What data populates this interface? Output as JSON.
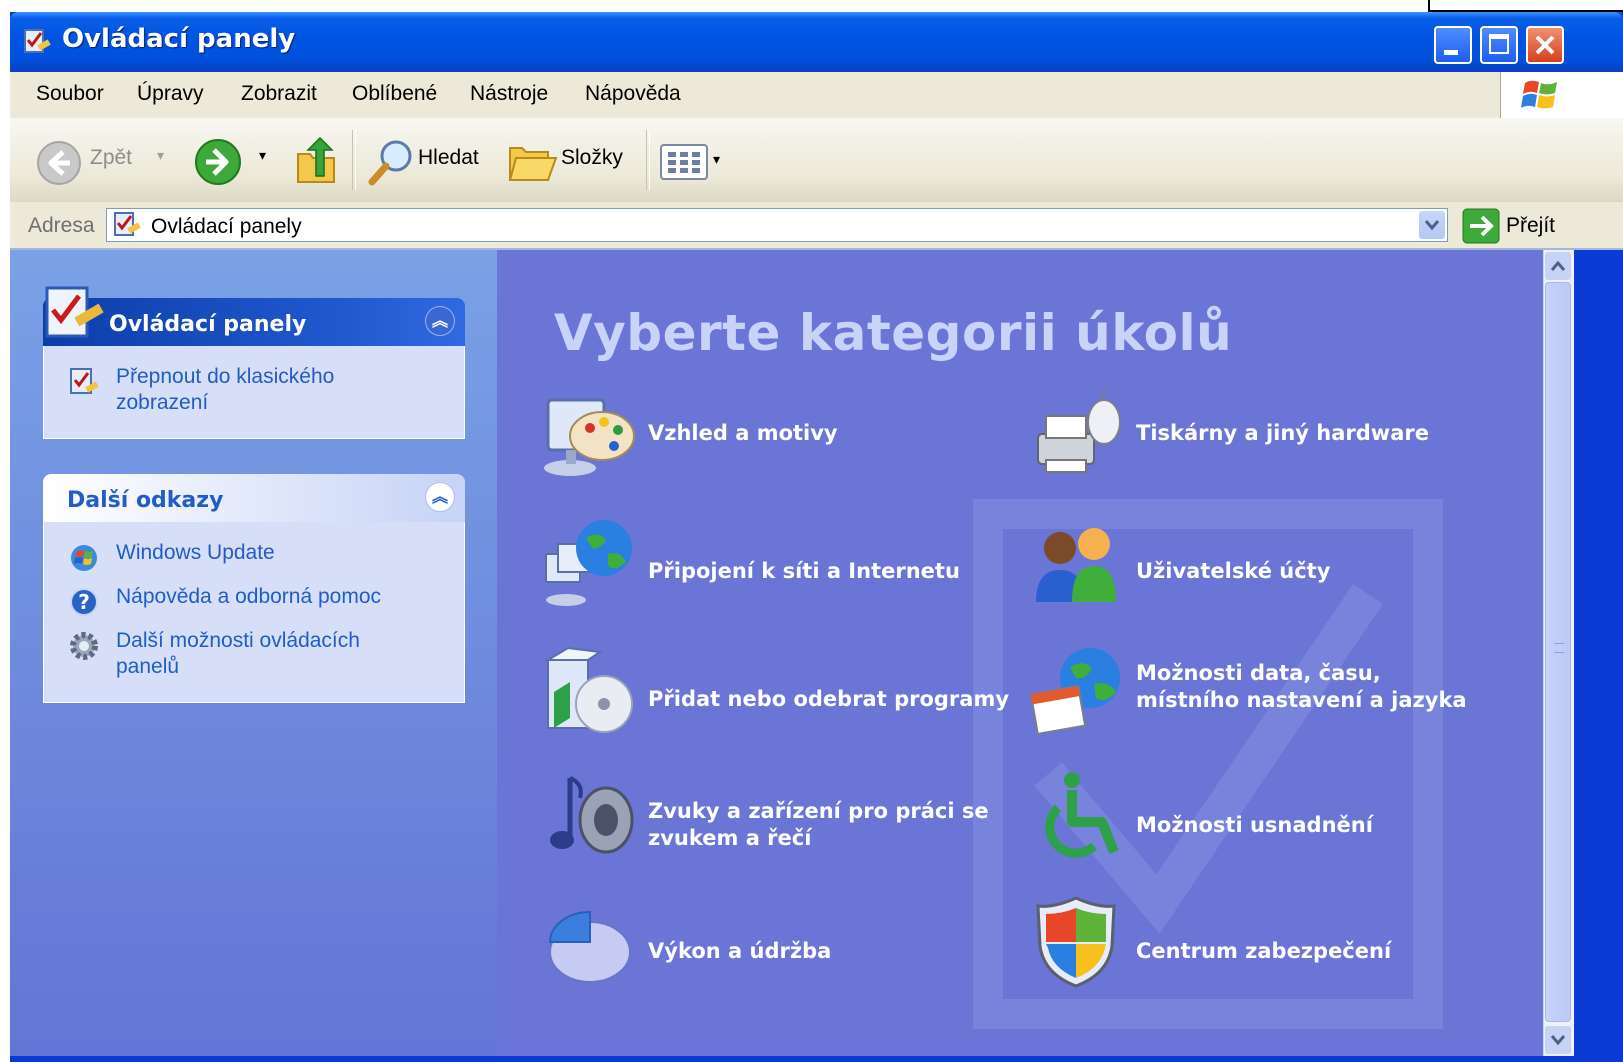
{
  "window": {
    "title": "Ovládací panely"
  },
  "menu": {
    "items": [
      {
        "label": "Soubor"
      },
      {
        "label": "Úpravy"
      },
      {
        "label": "Zobrazit"
      },
      {
        "label": "Oblíbené"
      },
      {
        "label": "Nástroje"
      },
      {
        "label": "Nápověda"
      }
    ]
  },
  "toolbar": {
    "back_label": "Zpět",
    "search_label": "Hledat",
    "folders_label": "Složky"
  },
  "address": {
    "label": "Adresa",
    "value": "Ovládací panely",
    "go_label": "Přejít"
  },
  "left_panels": {
    "control_panel": {
      "title": "Ovládací panely",
      "links": [
        {
          "label": "Přepnout do klasického zobrazení",
          "icon": "switch-view-icon"
        }
      ]
    },
    "other_links": {
      "title": "Další odkazy",
      "links": [
        {
          "label": "Windows Update",
          "icon": "windows-update-icon"
        },
        {
          "label": "Nápověda a odborná pomoc",
          "icon": "help-icon"
        },
        {
          "label": "Další možnosti ovládacích panelů",
          "icon": "gear-icon"
        }
      ]
    }
  },
  "main": {
    "title": "Vyberte kategorii úkolů",
    "categories": [
      {
        "label": "Vzhled a motivy",
        "icon": "appearance-palette-icon"
      },
      {
        "label": "Tiskárny a jiný hardware",
        "icon": "printer-icon"
      },
      {
        "label": "Připojení k síti a Internetu",
        "icon": "network-globe-icon"
      },
      {
        "label": "Uživatelské účty",
        "icon": "user-accounts-icon"
      },
      {
        "label": "Přidat nebo odebrat programy",
        "icon": "add-remove-programs-icon"
      },
      {
        "label": "Možnosti data, času, místního nastavení a jazyka",
        "icon": "date-time-globe-icon"
      },
      {
        "label": "Zvuky a zařízení pro práci se zvukem a řečí",
        "icon": "sound-speaker-icon"
      },
      {
        "label": "Možnosti usnadnění",
        "icon": "accessibility-icon"
      },
      {
        "label": "Výkon a údržba",
        "icon": "performance-pie-icon"
      },
      {
        "label": "Centrum zabezpečení",
        "icon": "security-shield-icon"
      }
    ]
  },
  "colors": {
    "titlebar": "#0054e3",
    "main_background": "#6a75d6",
    "task_link": "#215dc6",
    "panel_body": "#d6dff7"
  }
}
